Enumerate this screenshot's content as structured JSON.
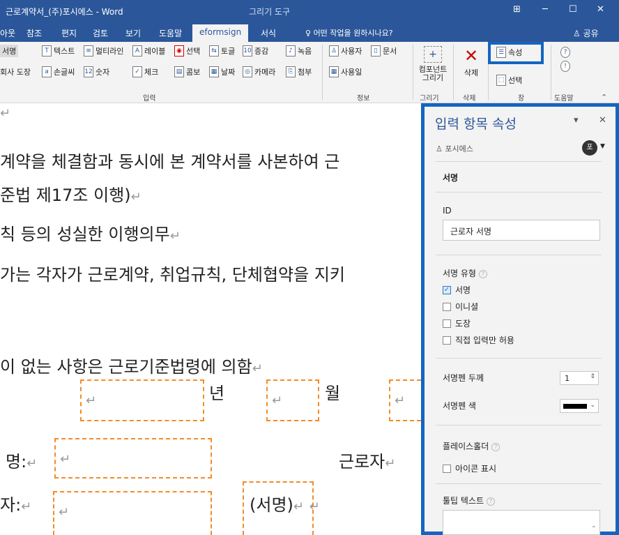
{
  "window": {
    "title": "근로계약서_(주)포시에스 - Word",
    "context_tab": "그리기 도구",
    "ctrl_icon": "⊞",
    "min": "─",
    "max": "☐",
    "close": "✕"
  },
  "menu": {
    "items": [
      "아웃",
      "참조",
      "편지",
      "검토",
      "보기",
      "도움말",
      "eformsign",
      "서식"
    ],
    "search": "어떤 작업을 원하시나요?",
    "share": "공유"
  },
  "ribbon": {
    "signature": "서명",
    "company_stamp": "회사 도장",
    "text": "텍스트",
    "handwriting": "손글씨",
    "multiline": "멀티라인",
    "number": "숫자",
    "label": "레이블",
    "check": "체크",
    "select": "선택",
    "combo": "콤보",
    "toggle": "토글",
    "date": "날짜",
    "camera": "카메라",
    "increment": "증감",
    "record": "녹음",
    "attach": "첨부",
    "input_group": "입력",
    "user": "사용자",
    "document": "문서",
    "user_date": "사용일",
    "info_group": "정보",
    "draw_component": "컴포넌트 그리기",
    "draw_group": "그리기",
    "delete": "삭제",
    "delete_group": "삭제",
    "properties": "속성",
    "choose": "선택",
    "window_group": "창",
    "help_group": "도움말"
  },
  "doc": {
    "line1": "계약을 체결함과 동시에 본 계약서를 사본하여 근",
    "line2": "준법 제17조 이행)",
    "line3": "칙 등의 성실한 이행의무",
    "line4": "가는 각자가 근로계약, 취업규칙, 단체협약을 지키",
    "line5": "이 없는 사항은 근로기준법령에 의함",
    "year": "년",
    "month": "월",
    "name": "명:",
    "worker": "근로자",
    "person": "자:",
    "sign": "(서명)",
    "para_mark": "↵"
  },
  "panel": {
    "title": "입력 항목 속성",
    "dropdown": "▾",
    "close": "✕",
    "owner": "포시에스",
    "avatar": "포",
    "section": "서명",
    "id_label": "ID",
    "id_value": "근로자 서명",
    "sig_type_label": "서명 유형",
    "sig_types": [
      {
        "label": "서명",
        "checked": true
      },
      {
        "label": "이니셜",
        "checked": false
      },
      {
        "label": "도장",
        "checked": false
      },
      {
        "label": "직접 입력만 허용",
        "checked": false
      }
    ],
    "pen_width_label": "서명펜 두께",
    "pen_width_value": "1",
    "pen_color_label": "서명펜 색",
    "placeholder_label": "플레이스홀더",
    "show_icon": "아이콘 표시",
    "tooltip_label": "툴팁 텍스트",
    "accent": "#1565c0"
  }
}
